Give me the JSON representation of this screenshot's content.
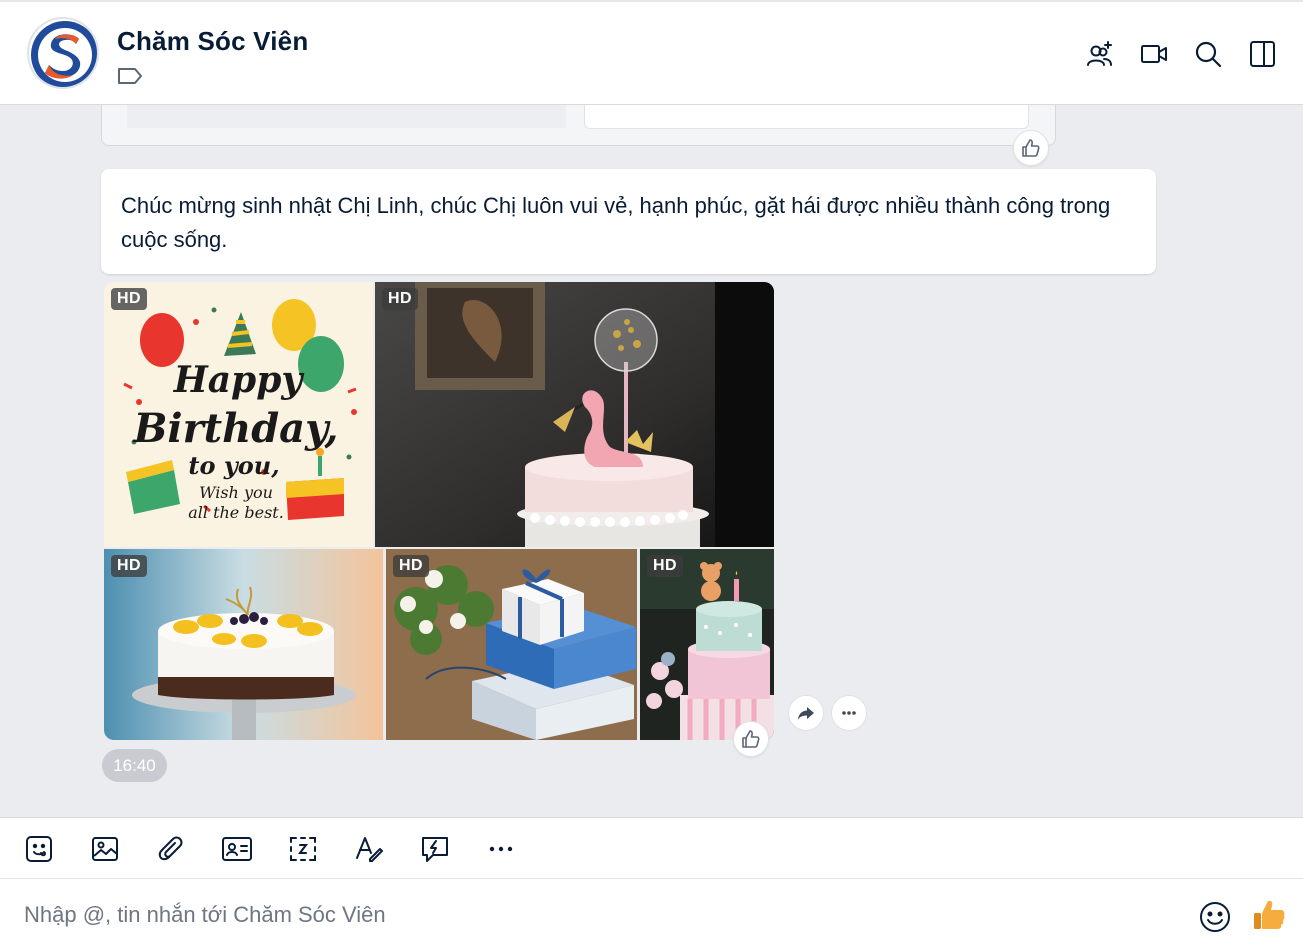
{
  "header": {
    "title": "Chăm Sóc Viên",
    "icons": [
      "add-member-icon",
      "video-call-icon",
      "search-icon",
      "sidebar-toggle-icon"
    ]
  },
  "message": {
    "text": "Chúc mừng sinh nhật Chị Linh, chúc Chị luôn vui vẻ, hạnh phúc, gặt hái được nhiều thành công trong cuộc sống.",
    "photos": [
      {
        "badge": "HD",
        "alt": "happy-birthday-card",
        "text_lines": [
          "Happy",
          "Birthday,",
          "to you,",
          "Wish you",
          "all the best."
        ]
      },
      {
        "badge": "HD",
        "alt": "flamingo-cake"
      },
      {
        "badge": "HD",
        "alt": "fruit-cake"
      },
      {
        "badge": "HD",
        "alt": "gift-boxes"
      },
      {
        "badge": "HD",
        "alt": "teddy-bear-cake"
      }
    ],
    "time": "16:40"
  },
  "composer": {
    "placeholder": "Nhập @, tin nhắn tới Chăm Sóc Viên",
    "toolbar_icons": [
      "sticker-icon",
      "image-icon",
      "attach-icon",
      "contact-card-icon",
      "screenshot-icon",
      "text-format-icon",
      "quick-message-icon",
      "more-icon"
    ]
  },
  "colors": {
    "accent": "#0068ff",
    "chat_bg": "#ebecf0",
    "text": "#081c36",
    "icon": "#081c36",
    "thumb": "#f2a93b"
  }
}
